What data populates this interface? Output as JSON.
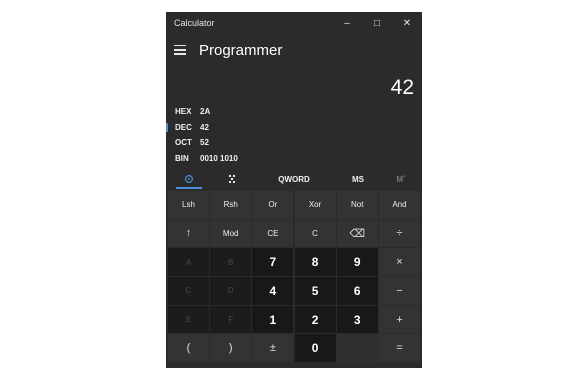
{
  "window": {
    "title": "Calculator",
    "minimize_glyph": "–",
    "maximize_glyph": "□",
    "close_glyph": "✕"
  },
  "header": {
    "mode_title": "Programmer"
  },
  "display": {
    "value": "42"
  },
  "radix": [
    {
      "label": "HEX",
      "value": "2A"
    },
    {
      "label": "DEC",
      "value": "42"
    },
    {
      "label": "OCT",
      "value": "52"
    },
    {
      "label": "BIN",
      "value": "0010 1010"
    }
  ],
  "toolbar": {
    "word_size": "QWORD",
    "memory_store": "MS",
    "memory_view": "Mˇ"
  },
  "keypad": {
    "rows": [
      [
        "Lsh",
        "Rsh",
        "Or",
        "Xor",
        "Not",
        "And"
      ],
      [
        "↑",
        "Mod",
        "CE",
        "C",
        "⌫",
        "÷"
      ],
      [
        "A",
        "B",
        "7",
        "8",
        "9",
        "×"
      ],
      [
        "C",
        "D",
        "4",
        "5",
        "6",
        "−"
      ],
      [
        "E",
        "F",
        "1",
        "2",
        "3",
        "+"
      ],
      [
        "(",
        ")",
        "±",
        "0",
        ".",
        "="
      ]
    ]
  },
  "colors": {
    "background": "#2b2b2b",
    "accent": "#4c8fd6",
    "digit_key": "#181818",
    "operator_key": "#333333"
  }
}
